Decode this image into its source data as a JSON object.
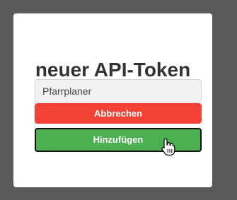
{
  "dialog": {
    "title": "neuer API-Token",
    "token_input": {
      "value": "Pfarrplaner",
      "placeholder": ""
    },
    "cancel_label": "Abbrechen",
    "add_label": "Hinzufügen"
  },
  "colors": {
    "backdrop": "#5a5a5a",
    "cancel": "#f44336",
    "add": "#4caf50",
    "title": "#333333"
  },
  "icons": {
    "cursor": "hand-pointer-cursor-icon"
  }
}
